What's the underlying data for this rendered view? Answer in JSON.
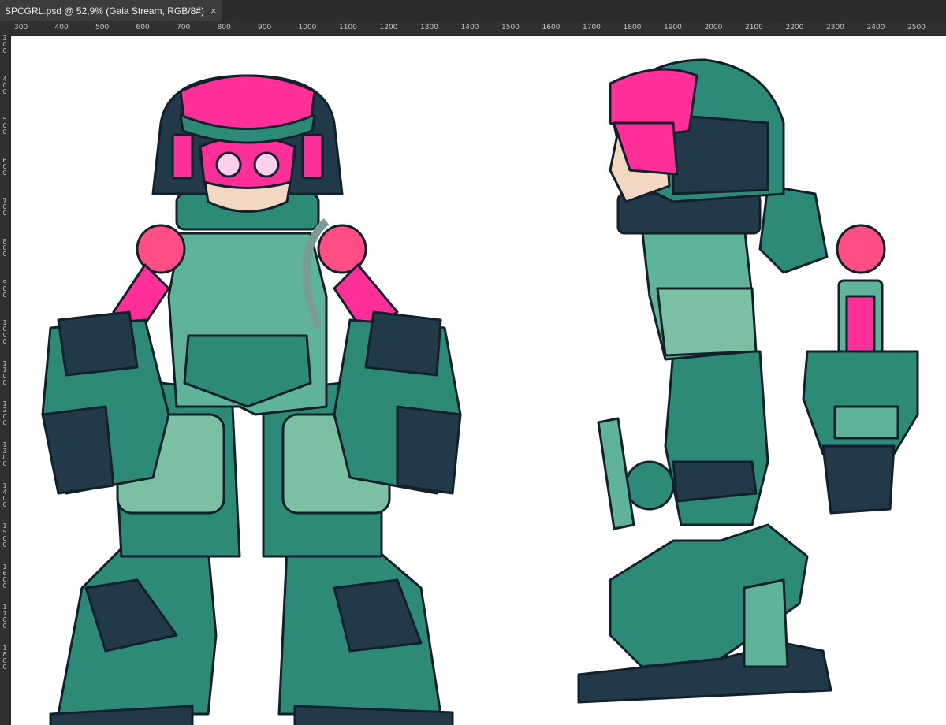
{
  "document_tab": {
    "title": "SPCGRL.psd @ 52,9% (Gaia Stream, RGB/8#)",
    "close_glyph": "×"
  },
  "ruler": {
    "horizontal_labels": [
      "300",
      "400",
      "500",
      "600",
      "700",
      "800",
      "900",
      "1000",
      "1100",
      "1200",
      "1300",
      "1400",
      "1500",
      "1600",
      "1700",
      "1800",
      "1900",
      "2000",
      "2100",
      "2200",
      "2300",
      "2400",
      "2500"
    ],
    "vertical_labels": [
      "300",
      "400",
      "500",
      "600",
      "700",
      "800",
      "900",
      "1000",
      "1100",
      "1200",
      "1300",
      "1400",
      "1500",
      "1600",
      "1700",
      "1800"
    ]
  },
  "colors": {
    "app_chrome": "#2b2b2b",
    "ruler_bg": "#303030",
    "suit_teal": "#2e8a78",
    "suit_mint": "#5fb39a",
    "suit_dark": "#22394a",
    "accent_magenta": "#ff2f9a",
    "accent_pink": "#ff4d86"
  },
  "canvas": {
    "artwork": "space girl character turnaround (front and side views)"
  }
}
